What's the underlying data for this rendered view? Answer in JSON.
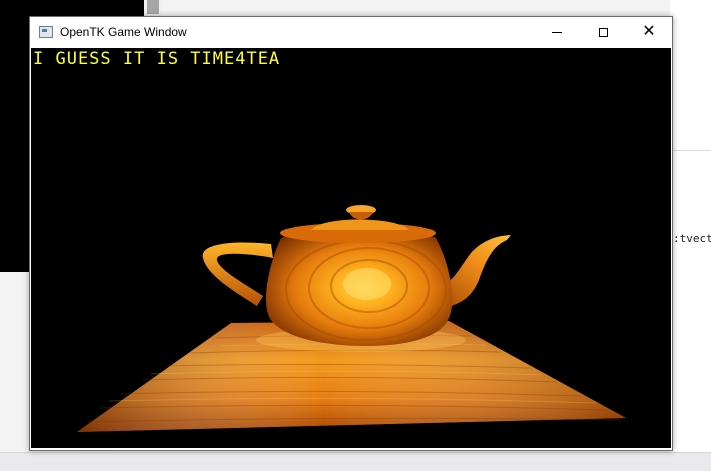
{
  "window": {
    "title": "OpenTK Game Window"
  },
  "controls": {
    "minimize": "minimize",
    "maximize": "maximize",
    "close": "✕"
  },
  "viewport": {
    "overlay_text": "I GUESS IT IS TIME4TEA"
  },
  "background": {
    "editor_snippet": ":tvecto"
  },
  "colors": {
    "overlay_text": "#ffff36",
    "viewport_bg": "#000000",
    "wood": "#e07a10"
  }
}
